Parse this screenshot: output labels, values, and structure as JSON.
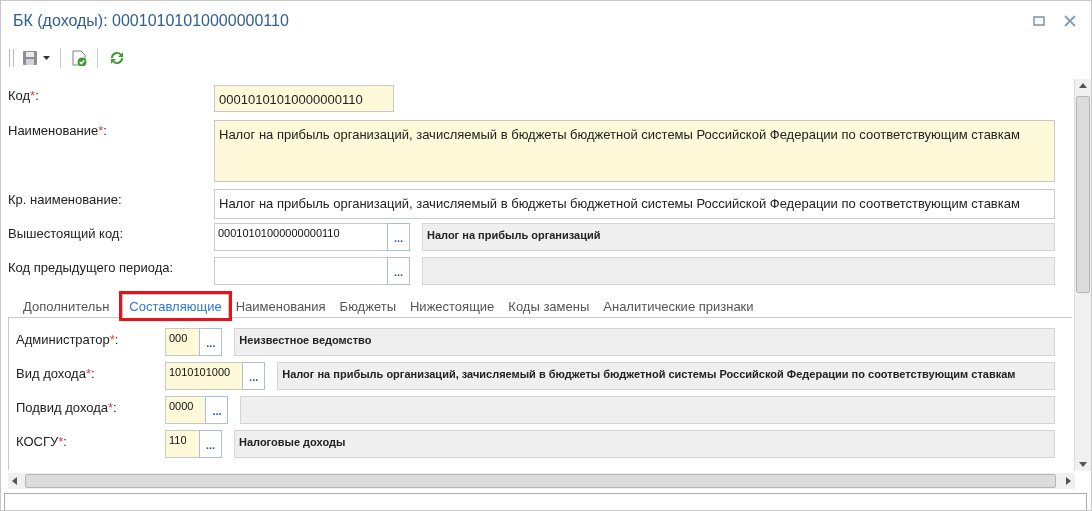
{
  "window": {
    "title": "БК (доходы): 00010101010000000110"
  },
  "toolbar": {
    "buttons": [
      {
        "kind": "save",
        "has_menu": true
      },
      {
        "kind": "check"
      },
      {
        "kind": "refresh"
      }
    ]
  },
  "fields": [
    {
      "kind": "text",
      "label": "Код",
      "required_mark": "*",
      "label_end": ":",
      "required": true,
      "value": "00010101010000000110"
    },
    {
      "kind": "memo",
      "label": "Наименование",
      "required_mark": "*",
      "label_end": ":",
      "required": true,
      "value": "Налог на прибыль организаций, зачисляемый в бюджеты бюджетной системы Российской Федерации по соответствующим ставкам"
    },
    {
      "kind": "line",
      "label": "Кр. наименование",
      "label_end": ":",
      "required": false,
      "value": "Налог на прибыль организаций, зачисляемый в бюджеты бюджетной системы Российской Федерации по соответствующим ставкам"
    },
    {
      "kind": "lookup",
      "label": "Вышестоящий код",
      "label_end": ":",
      "required": false,
      "value": "00010101000000000110",
      "button": "...",
      "name": "Налог на прибыль организаций"
    },
    {
      "kind": "lookup",
      "label": "Код предыдущего периода",
      "label_end": ":",
      "required": false,
      "button": "..."
    }
  ],
  "tabs": [
    {
      "label": "Дополнительн",
      "selected": false,
      "highlighted": false
    },
    {
      "label": "Составляющие",
      "selected": true,
      "highlighted": true
    },
    {
      "label": "Наименования",
      "selected": false,
      "highlighted": false
    },
    {
      "label": "Бюджеты",
      "selected": false,
      "highlighted": false
    },
    {
      "label": "Нижестоящие",
      "selected": false,
      "highlighted": false
    },
    {
      "label": "Коды замены",
      "selected": false,
      "highlighted": false
    },
    {
      "label": "Аналитические признаки",
      "selected": false,
      "highlighted": false
    }
  ],
  "tab_fields": [
    {
      "kind": "lookup",
      "label": "Администратор",
      "required_mark": "*",
      "label_end": ":",
      "required": true,
      "value": "000",
      "button": "...",
      "name": "Неизвестное ведомство"
    },
    {
      "kind": "lookup",
      "label": "Вид дохода",
      "required_mark": "*",
      "label_end": ":",
      "required": true,
      "value": "1010101000",
      "button": "...",
      "name": "Налог на прибыль организаций, зачисляемый в бюджеты бюджетной системы Российской Федерации по соответствующим ставкам"
    },
    {
      "kind": "lookup",
      "label": "Подвид дохода",
      "required_mark": "*",
      "label_end": ":",
      "required": true,
      "value": "0000",
      "button": "..."
    },
    {
      "kind": "lookup",
      "label": "КОСГУ",
      "required_mark": "*",
      "label_end": ":",
      "required": true,
      "value": "110",
      "button": "...",
      "name": "Налоговые доходы"
    }
  ]
}
